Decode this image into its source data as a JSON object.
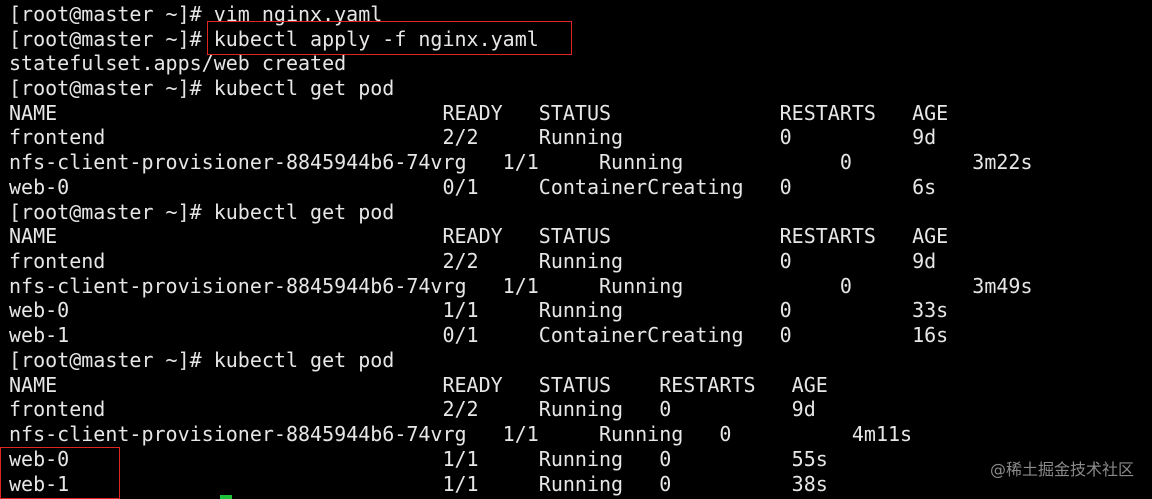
{
  "terminal": {
    "lines": [
      "[root@master ~]# vim nginx.yaml",
      "[root@master ~]# kubectl apply -f nginx.yaml",
      "statefulset.apps/web created",
      "[root@master ~]# kubectl get pod",
      "NAME                                READY   STATUS              RESTARTS   AGE",
      "frontend                            2/2     Running             0          9d",
      "nfs-client-provisioner-8845944b6-74vrg   1/1     Running             0          3m22s",
      "web-0                               0/1     ContainerCreating   0          6s",
      "[root@master ~]# kubectl get pod",
      "NAME                                READY   STATUS              RESTARTS   AGE",
      "frontend                            2/2     Running             0          9d",
      "nfs-client-provisioner-8845944b6-74vrg   1/1     Running             0          3m49s",
      "web-0                               1/1     Running             0          33s",
      "web-1                               0/1     ContainerCreating   0          16s",
      "[root@master ~]# kubectl get pod",
      "NAME                                READY   STATUS    RESTARTS   AGE",
      "frontend                            2/2     Running   0          9d",
      "nfs-client-provisioner-8845944b6-74vrg   1/1     Running   0          4m11s",
      "web-0                               1/1     Running   0          55s",
      "web-1                               1/1     Running   0          38s"
    ]
  },
  "watermark": "@稀土掘金技术社区",
  "colors": {
    "background": "#000000",
    "text": "#e6e6e6",
    "highlight_border": "#e02424",
    "cursor": "#1ec23a"
  }
}
